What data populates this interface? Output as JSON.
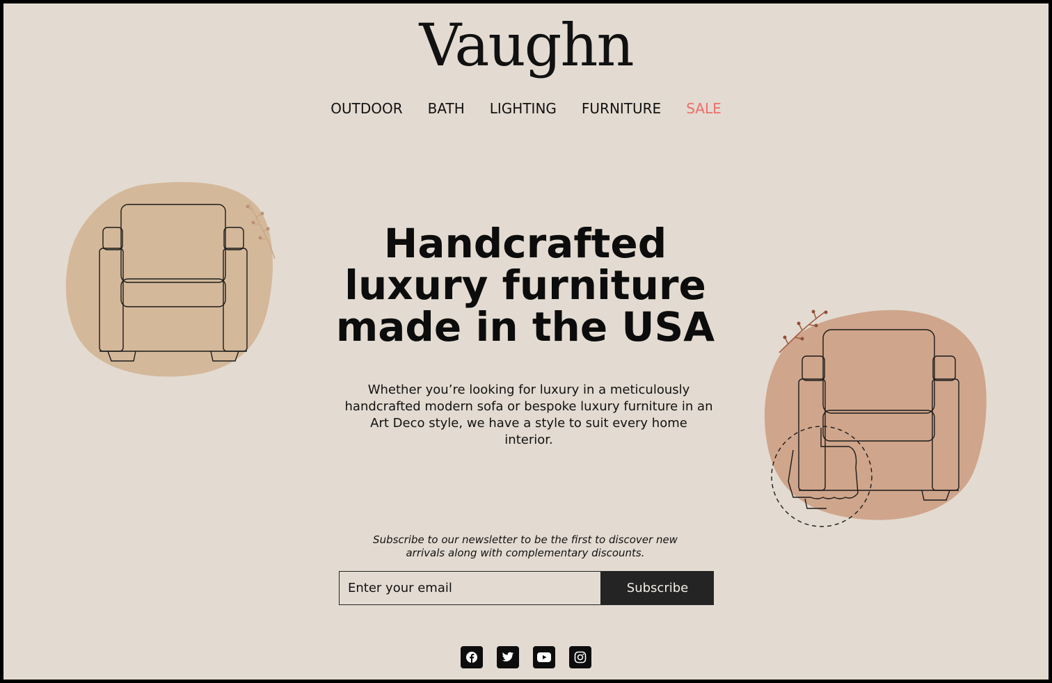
{
  "brand": {
    "logo": "Vaughn"
  },
  "nav": {
    "items": [
      "OUTDOOR",
      "BATH",
      "LIGHTING",
      "FURNITURE"
    ],
    "sale": "SALE",
    "sale_color": "#ee6d6a"
  },
  "hero": {
    "title_lines": [
      "Handcrafted",
      "luxury furniture",
      "made in the USA"
    ],
    "description": "Whether you’re looking for luxury in a meticulously handcrafted modern sofa or bespoke luxury furniture in an Art Deco style, we have a style to suit every home interior."
  },
  "newsletter": {
    "text": "Subscribe to our newsletter to be the first to discover new arrivals along with complementary discounts.",
    "email_placeholder": "Enter your email",
    "button_label": "Subscribe"
  },
  "social": {
    "icons": [
      "facebook-icon",
      "twitter-icon",
      "youtube-icon",
      "instagram-icon"
    ]
  },
  "colors": {
    "background": "#e3dbd1",
    "blob_left": "#d4b89a",
    "blob_right": "#cfa58b",
    "button_bg": "#242424"
  }
}
